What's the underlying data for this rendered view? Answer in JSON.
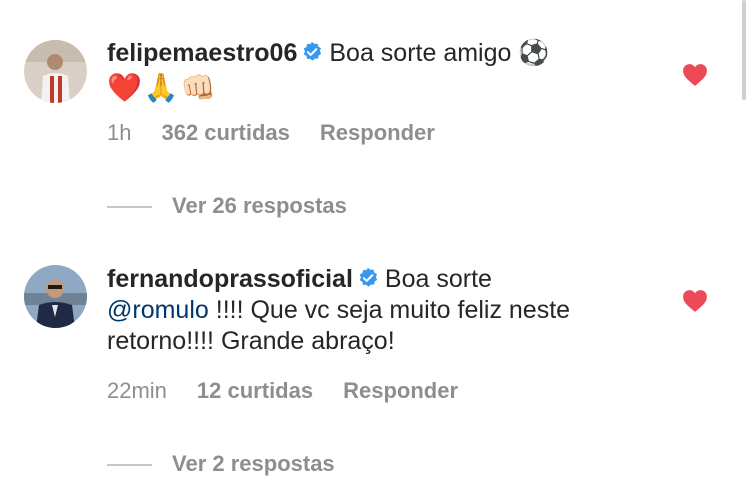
{
  "comments": [
    {
      "username": "felipemaestro06",
      "text": "Boa sorte amigo",
      "emoji_inline": "⚽",
      "emoji_line": [
        "❤️",
        "🙏",
        "👊🏻"
      ],
      "time": "1h",
      "likes": "362 curtidas",
      "reply_label": "Responder",
      "view_replies": "Ver 26 respostas",
      "liked": true
    },
    {
      "username": "fernandoprassoficial",
      "text_first": "Boa sorte",
      "mention": "@romulo",
      "text_rest": " !!!! Que vc seja muito feliz neste retorno!!!! Grande abraço!",
      "time": "22min",
      "likes": "12 curtidas",
      "reply_label": "Responder",
      "view_replies": "Ver 2 respostas",
      "liked": true
    }
  ],
  "colors": {
    "verified": "#3897f0",
    "heart": "#ed4956",
    "secondary": "#8e8e8e",
    "mention": "#00376b"
  }
}
